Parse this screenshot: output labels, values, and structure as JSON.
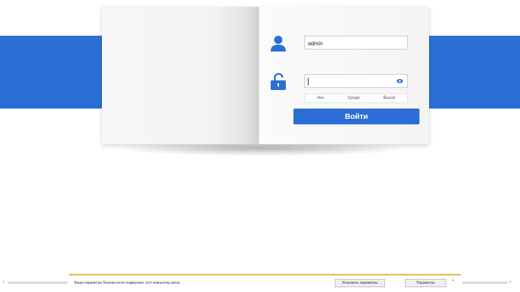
{
  "login": {
    "username_value": "admin",
    "password_value": "",
    "strength_labels": [
      "Низ",
      "Средн",
      "Высок"
    ],
    "login_button_label": "Войти"
  },
  "notification": {
    "message": "Ваши параметры безопасности подвергают этот компьютер риску.",
    "fix_button_label": "Исправить параметры",
    "settings_button_label": "Параметры",
    "close_label": "×"
  },
  "scroll": {
    "left_arrow": "‹",
    "right_arrow": "›"
  },
  "colors": {
    "accent": "#2b6fd6",
    "notification_border": "#f2b83a"
  },
  "icons": [
    "user-icon",
    "lock-open-icon",
    "eye-icon"
  ]
}
